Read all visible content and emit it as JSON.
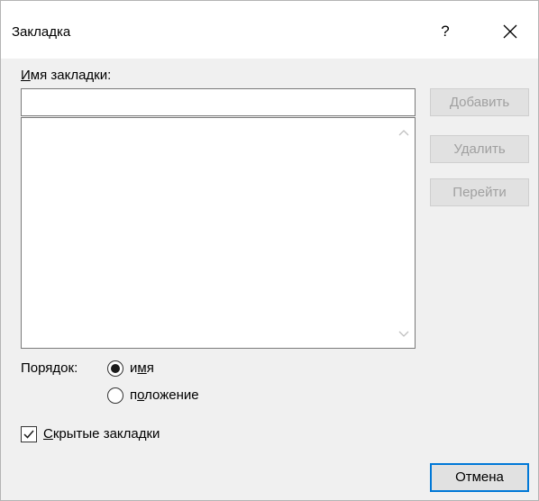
{
  "dialog": {
    "title": "Закладка",
    "help_label": "?",
    "close_icon": "close-icon"
  },
  "bookmark_name": {
    "label_accel": "И",
    "label_rest": "мя закладки:",
    "value": ""
  },
  "bookmark_list": {
    "items": []
  },
  "buttons": {
    "add": "Добавить",
    "delete": "Удалить",
    "goto": "Перейти",
    "cancel": "Отмена"
  },
  "sort": {
    "label": "Порядок:",
    "options": [
      {
        "pre": "и",
        "accel": "м",
        "post": "я",
        "selected": true
      },
      {
        "pre": "п",
        "accel": "о",
        "post": "ложение",
        "selected": false
      }
    ]
  },
  "hidden_bookmarks": {
    "accel": "С",
    "rest": "крытые закладки",
    "checked": true
  },
  "colors": {
    "dialog_bg": "#f0f0f0",
    "titlebar_bg": "#ffffff",
    "focus_border": "#0078d7",
    "disabled_text": "#a0a0a0"
  }
}
